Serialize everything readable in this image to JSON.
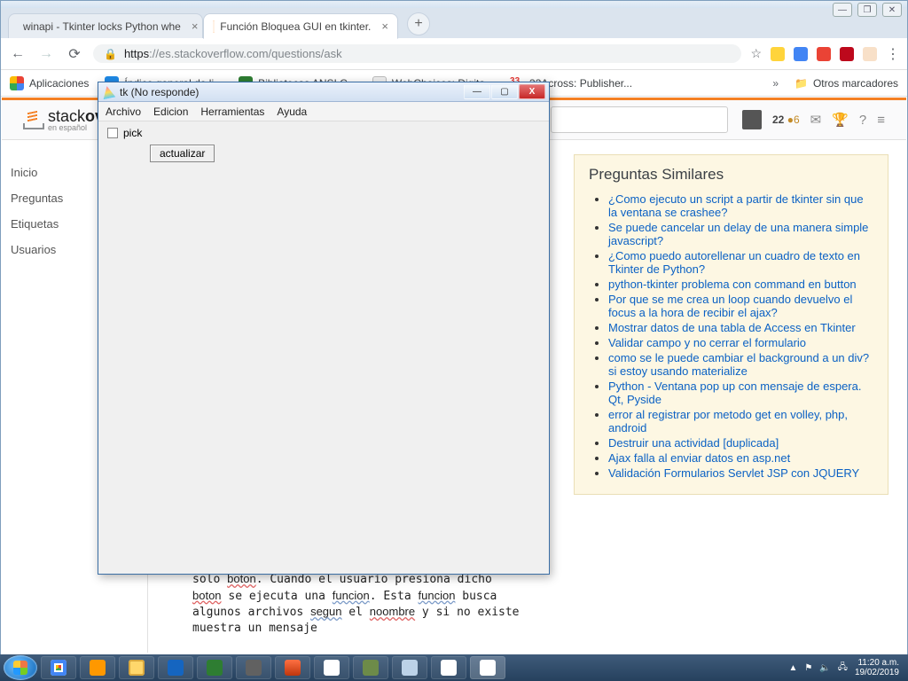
{
  "browser": {
    "tabs": [
      {
        "title": "winapi - Tkinter locks Python whe"
      },
      {
        "title": "Función Bloquea GUI en tkinter."
      }
    ],
    "win_min": "—",
    "win_max": "❐",
    "win_close": "✕",
    "newtab": "+",
    "nav": {
      "back": "←",
      "fwd": "→",
      "reload": "⟳"
    },
    "url_scheme": "https",
    "url_host": "://es.stackoverflow.com",
    "url_path": "/questions/ask",
    "star": "☆",
    "menu": "⋮"
  },
  "bookmarks": {
    "label_apps": "Aplicaciones",
    "items": [
      {
        "label": "Índice general de li...",
        "ic": "ic-blue"
      },
      {
        "label": "Bibliotecas ANSI C...",
        "ic": "ic-green"
      },
      {
        "label": "WebChoices: Digita...",
        "ic": "ic-doc"
      },
      {
        "label": "33Across: Publisher...",
        "ic": "ic-33",
        "ic_text": "33"
      }
    ],
    "chev": "»",
    "otros": "Otros marcadores"
  },
  "so": {
    "logo_a": "stack",
    "logo_b": "overflow",
    "logo_es": "en español",
    "rep": "22",
    "bronze_dot": "●",
    "bronze": "6",
    "icons": {
      "inbox": "✉",
      "trophy": "🏆",
      "help": "?",
      "bars": "≡"
    },
    "side": [
      "Inicio",
      "Preguntas",
      "Etiquetas",
      "Usuarios"
    ],
    "body": "solo <sq>boton</sq>. Cuando el usuario presiona dicho\n<sq>boton</sq> se ejecuta una <sq2>funcion</sq2>. Esta <sq2>funcion</sq2> busca\nalgunos archivos <sq2>segun</sq2> el <sq>noombre</sq> y si no existe\nmuestra un mensaje",
    "similar_title": "Preguntas Similares",
    "similar": [
      "¿Como ejecuto un script a partir de tkinter sin que la ventana se crashee?",
      "Se puede cancelar un delay de una manera simple javascript?",
      "¿Como puedo autorellenar un cuadro de texto en Tkinter de Python?",
      "python-tkinter problema con command en button",
      "Por que se me crea un loop cuando devuelvo el focus a la hora de recibir el ajax?",
      "Mostrar datos de una tabla de Access en Tkinter",
      "Validar campo y no cerrar el formulario",
      "como se le puede cambiar el background a un div? si estoy usando materialize",
      "Python - Ventana pop up con mensaje de espera. Qt, Pyside",
      "error al registrar por metodo get en volley, php, android",
      "Destruir una actividad [duplicada]",
      "Ajax falla al enviar datos en asp.net",
      "Validación Formularios Servlet JSP con JQUERY"
    ]
  },
  "tk": {
    "title": "tk (No responde)",
    "menu": [
      "Archivo",
      "Edicion",
      "Herramientas",
      "Ayuda"
    ],
    "check_label": "pick",
    "button": "actualizar",
    "min": "—",
    "max": "▢",
    "close": "X"
  },
  "taskbar": {
    "tray_caret": "▲",
    "tray_flag": "⚑",
    "tray_vol": "🔈",
    "tray_net": "🖧",
    "time": "11:20 a.m.",
    "date": "19/02/2019"
  }
}
